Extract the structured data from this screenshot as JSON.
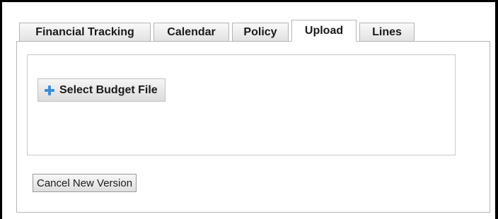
{
  "tabs": [
    {
      "label": "Financial Tracking",
      "active": false
    },
    {
      "label": "Calendar",
      "active": false
    },
    {
      "label": "Policy",
      "active": false
    },
    {
      "label": "Upload",
      "active": true
    },
    {
      "label": "Lines",
      "active": false
    }
  ],
  "upload": {
    "select_label": "Select Budget File",
    "select_icon": "plus-icon",
    "cancel_label": "Cancel New Version"
  },
  "colors": {
    "plus_icon": "#3a8fd6",
    "border": "#b4b4b4"
  }
}
